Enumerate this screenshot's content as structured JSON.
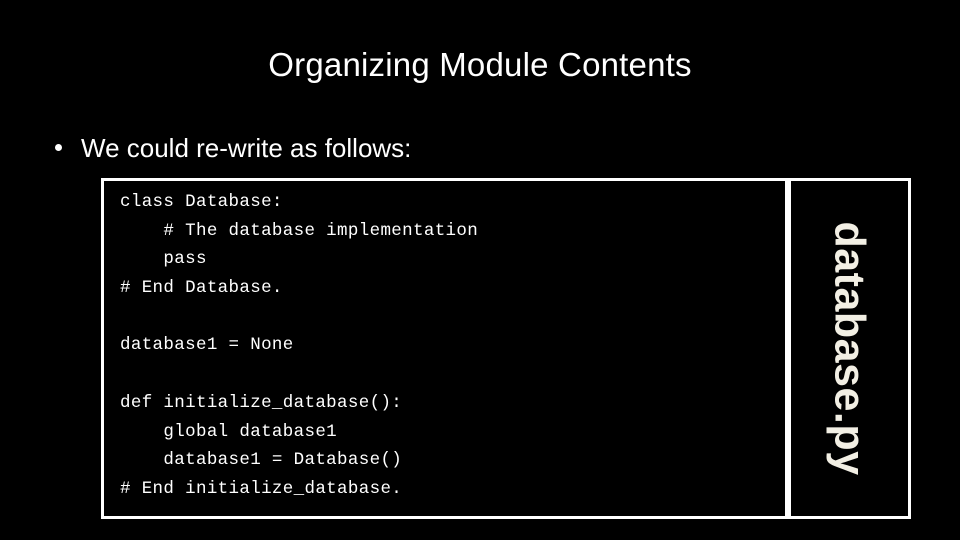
{
  "slide": {
    "title": "Organizing Module Contents",
    "background_color": "#000000",
    "text_color": "#ffffff",
    "accent_color": "#f2efe4"
  },
  "bullet": {
    "marker": "bullet-dot",
    "text": "We could re-write as follows:"
  },
  "code_block": {
    "language": "python",
    "border_color": "#ffffff",
    "lines": [
      "class Database:",
      "    # The database implementation",
      "    pass",
      "# End Database.",
      "",
      "database1 = None",
      "",
      "def initialize_database():",
      "    global database1",
      "    database1 = Database()",
      "# End initialize_database."
    ]
  },
  "file_label": {
    "name": "database.py",
    "orientation": "vertical-rotated-90",
    "color": "#f2efe4"
  }
}
